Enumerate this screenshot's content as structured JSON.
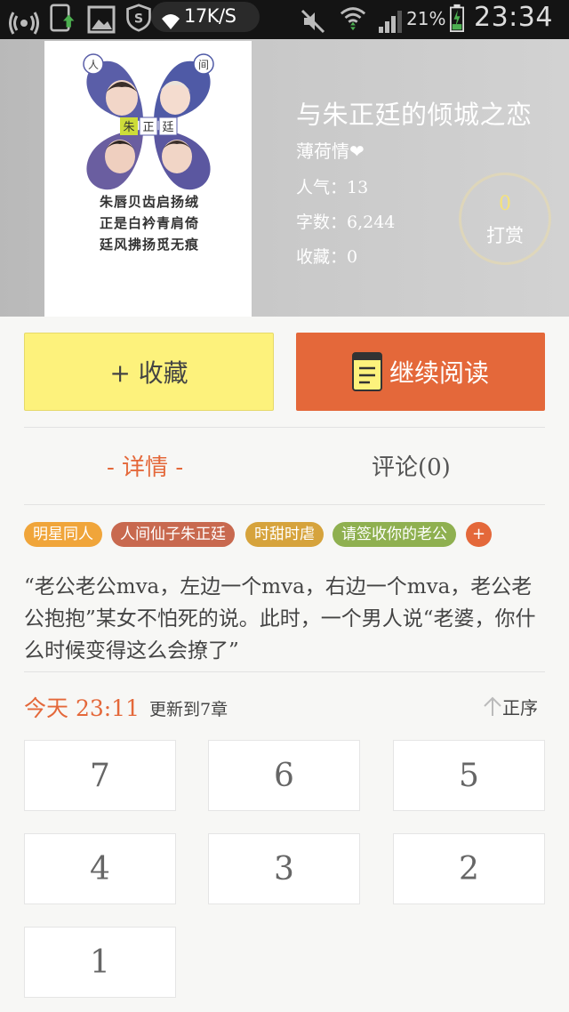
{
  "status_bar": {
    "network_speed": "17K/S",
    "battery_percent": "21%",
    "time": "23:34"
  },
  "book": {
    "title": "与朱正廷的倾城之恋",
    "author": "薄荷情❤",
    "popularity": "人气：13",
    "word_count": "字数：6,244",
    "favorites": "收藏：0",
    "cover": {
      "badge_chars": [
        "朱",
        "正",
        "廷"
      ],
      "corner_chars": [
        "人",
        "间"
      ],
      "poem_lines": [
        "朱唇贝齿启扬绒",
        "正是白衿青肩倚",
        "廷风拂扬觅无痕"
      ]
    }
  },
  "reward": {
    "count": "0",
    "label": "打赏"
  },
  "actions": {
    "collect_label": "+ 收藏",
    "read_label": "继续阅读"
  },
  "tabs": {
    "details": "- 详情 -",
    "comments": "评论(0)"
  },
  "tags": [
    {
      "label": "明星同人",
      "color": "#f0a53a"
    },
    {
      "label": "人间仙子朱正廷",
      "color": "#c8694f"
    },
    {
      "label": "时甜时虐",
      "color": "#d6a33c"
    },
    {
      "label": "请签收你的老公",
      "color": "#8fb050"
    }
  ],
  "add_tag_label": "+",
  "summary": "“老公老公mva，左边一个mva，右边一个mva，老公老公抱抱”某女不怕死的说。此时，一个男人说“老婆，你什么时候变得这么会撩了”",
  "update": {
    "time": "今天 23:11",
    "text": "更新到7章",
    "sort_label": "正序"
  },
  "chapters": [
    "7",
    "6",
    "5",
    "4",
    "3",
    "2",
    "1"
  ],
  "colors": {
    "accent": "#e4683a",
    "collect": "#fdf27c"
  }
}
